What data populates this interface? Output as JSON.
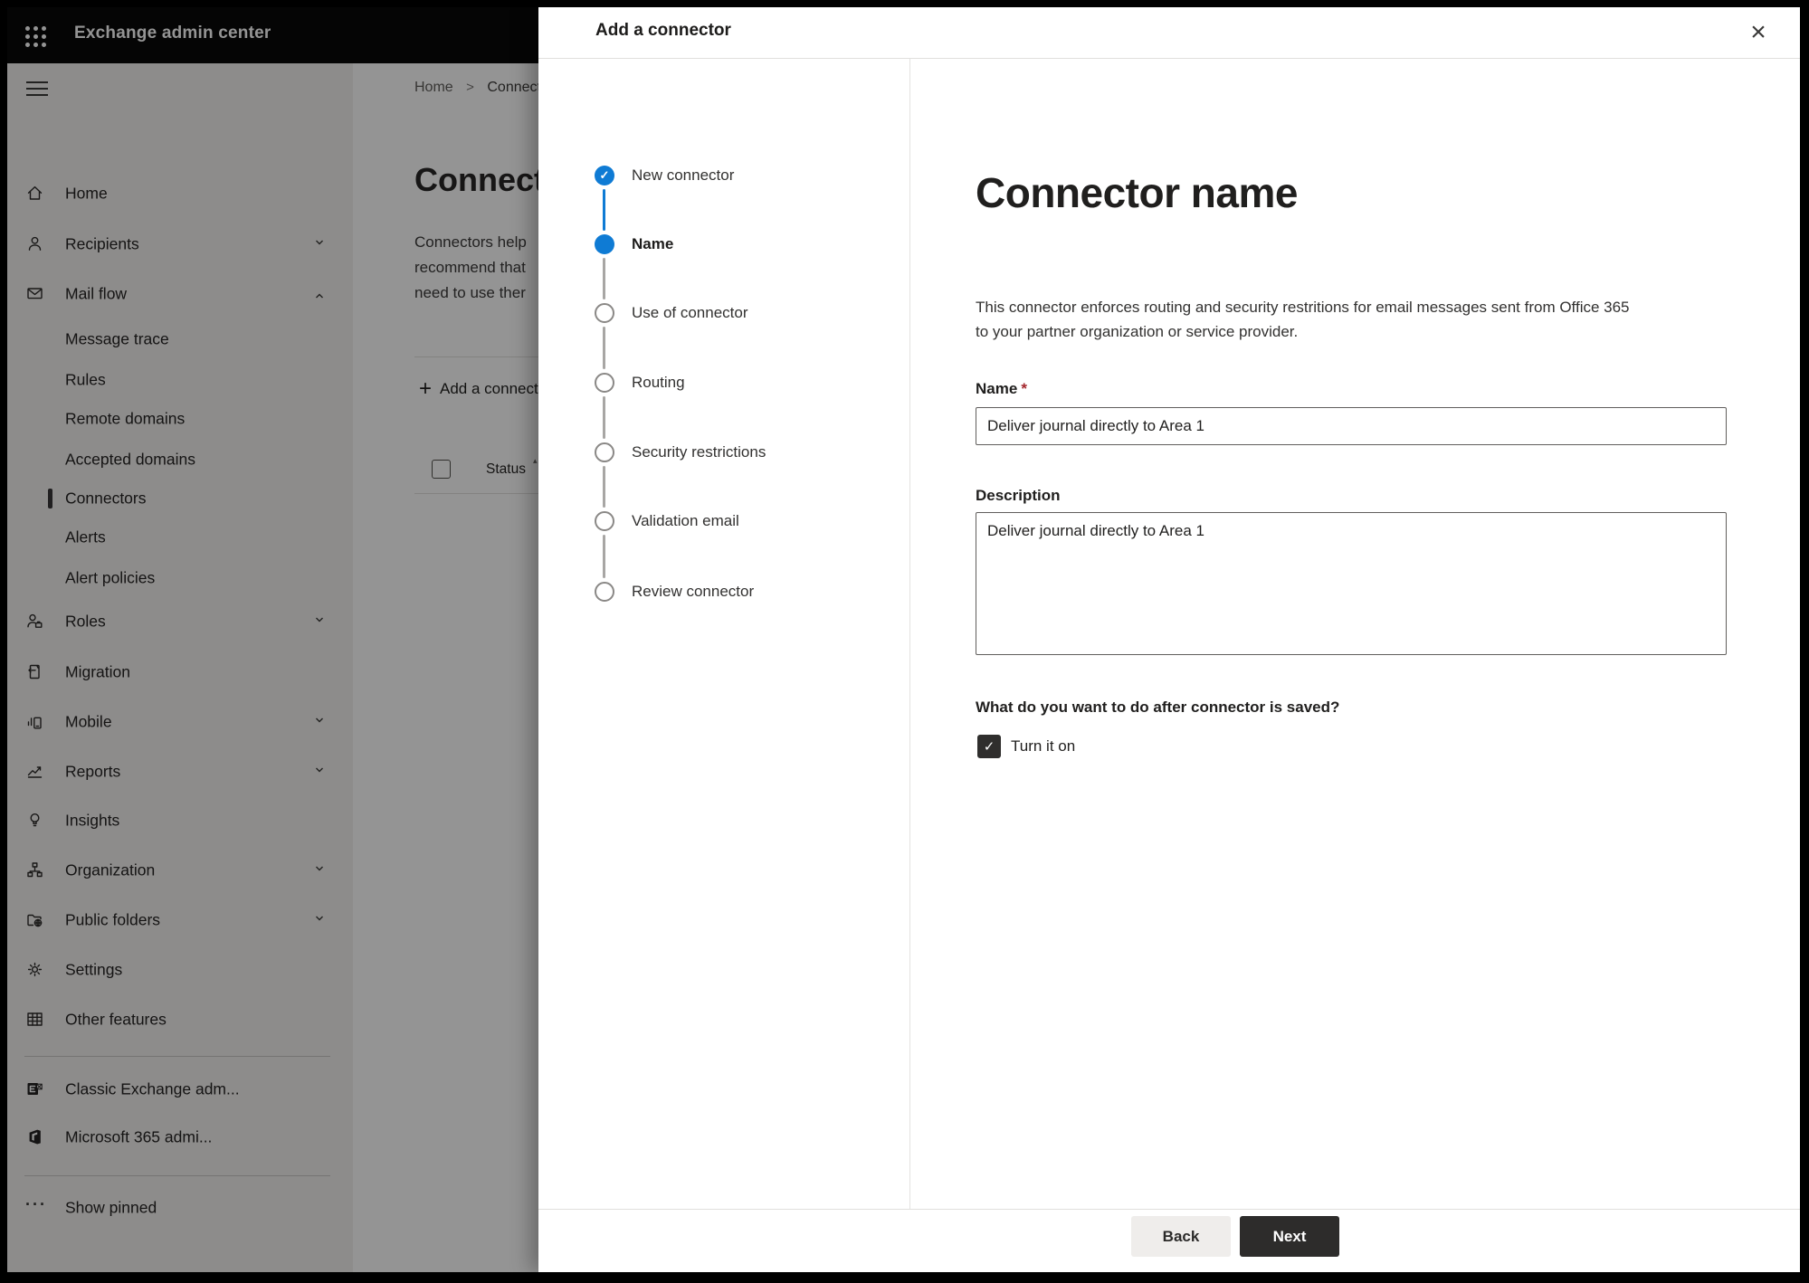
{
  "topbar": {
    "title": "Exchange admin center"
  },
  "sidebar": {
    "items": [
      {
        "label": "Home",
        "icon": "home-icon"
      },
      {
        "label": "Recipients",
        "icon": "person-icon",
        "chevron": "down"
      },
      {
        "label": "Mail flow",
        "icon": "mail-icon",
        "chevron": "up",
        "expanded": true
      },
      {
        "label": "Message trace",
        "indent": true
      },
      {
        "label": "Rules",
        "indent": true
      },
      {
        "label": "Remote domains",
        "indent": true
      },
      {
        "label": "Accepted domains",
        "indent": true
      },
      {
        "label": "Connectors",
        "indent": true,
        "selected": true
      },
      {
        "label": "Alerts",
        "indent": true
      },
      {
        "label": "Alert policies",
        "indent": true
      },
      {
        "label": "Roles",
        "icon": "roles-icon",
        "chevron": "down"
      },
      {
        "label": "Migration",
        "icon": "migration-icon"
      },
      {
        "label": "Mobile",
        "icon": "mobile-icon",
        "chevron": "down"
      },
      {
        "label": "Reports",
        "icon": "reports-icon",
        "chevron": "down"
      },
      {
        "label": "Insights",
        "icon": "lightbulb-icon"
      },
      {
        "label": "Organization",
        "icon": "org-chart-icon",
        "chevron": "down"
      },
      {
        "label": "Public folders",
        "icon": "folder-globe-icon",
        "chevron": "down"
      },
      {
        "label": "Settings",
        "icon": "gear-icon"
      },
      {
        "label": "Other features",
        "icon": "table-icon"
      },
      {
        "label": "Classic Exchange adm...",
        "icon": "exchange-logo-icon"
      },
      {
        "label": "Microsoft 365 admi...",
        "icon": "office-logo-icon"
      },
      {
        "label": "Show pinned",
        "icon": "ellipsis-icon"
      }
    ]
  },
  "page": {
    "breadcrumb": {
      "home": "Home",
      "separator": ">",
      "current": "Connectors"
    },
    "title": "Connectors",
    "intro_lines": [
      "Connectors help",
      "recommend that",
      "need to use ther"
    ],
    "add_button": {
      "plus_glyph": "+",
      "label": "Add a connector"
    },
    "table": {
      "status_header": "Status",
      "sort_glyph": "▴"
    }
  },
  "dialog": {
    "title": "Add a connector",
    "close_glyph": "×",
    "steps": [
      {
        "label": "New connector",
        "state": "completed",
        "check_glyph": "✓"
      },
      {
        "label": "Name",
        "state": "current"
      },
      {
        "label": "Use of connector",
        "state": "upcoming"
      },
      {
        "label": "Routing",
        "state": "upcoming"
      },
      {
        "label": "Security restrictions",
        "state": "upcoming"
      },
      {
        "label": "Validation email",
        "state": "upcoming"
      },
      {
        "label": "Review connector",
        "state": "upcoming"
      }
    ],
    "content": {
      "heading": "Connector name",
      "description_lines": [
        "This connector enforces routing and security restritions for email messages sent from Office 365",
        "to your partner organization or service provider."
      ],
      "name_label": "Name",
      "required_marker": "*",
      "name_value": "Deliver journal directly to Area 1",
      "description_label": "Description",
      "description_value": "Deliver journal directly to Area 1",
      "after_save_question": "What do you want to do after connector is saved?",
      "turn_on": {
        "label": "Turn it on",
        "checked": true,
        "check_glyph": "✓"
      }
    },
    "footer": {
      "back_label": "Back",
      "next_label": "Next"
    }
  },
  "colors": {
    "accent_blue": "#0f7bd4",
    "primary_button": "#2d2c2b",
    "required_red": "#a4262c",
    "topbar_black": "#0a0a0a"
  }
}
